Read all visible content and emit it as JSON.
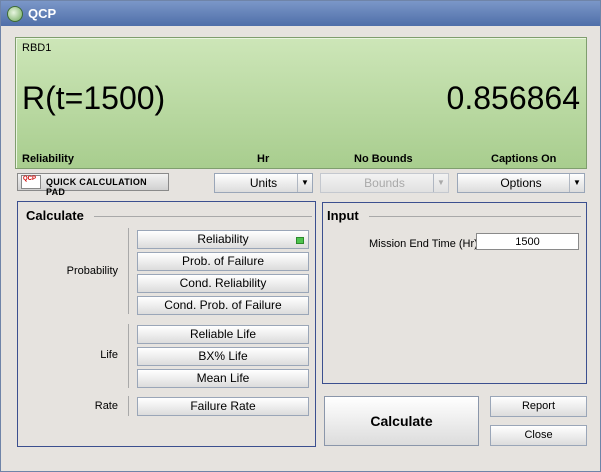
{
  "window": {
    "title": "QCP"
  },
  "display": {
    "model": "RBD1",
    "formula": "R(t=1500)",
    "result": "0.856864",
    "status": [
      "Reliability",
      "Hr",
      "No Bounds",
      "Captions On"
    ]
  },
  "toolbar": {
    "qcp_icon": "QCP",
    "qcp_label": "Quick Calculation Pad",
    "units": "Units",
    "bounds": "Bounds",
    "options": "Options"
  },
  "calculate": {
    "title": "Calculate",
    "probability_label": "Probability",
    "probability_buttons": [
      "Reliability",
      "Prob. of Failure",
      "Cond. Reliability",
      "Cond. Prob. of Failure"
    ],
    "life_label": "Life",
    "life_buttons": [
      "Reliable Life",
      "BX% Life",
      "Mean Life"
    ],
    "rate_label": "Rate",
    "rate_buttons": [
      "Failure Rate"
    ]
  },
  "input": {
    "title": "Input",
    "mission_label": "Mission End Time (Hr)",
    "mission_value": "1500"
  },
  "actions": {
    "calculate": "Calculate",
    "report": "Report",
    "close": "Close"
  },
  "colors": {
    "display_bg": "#b9dba0",
    "panel_border": "#3b4f8f",
    "active_indicator": "#4ec34e"
  }
}
